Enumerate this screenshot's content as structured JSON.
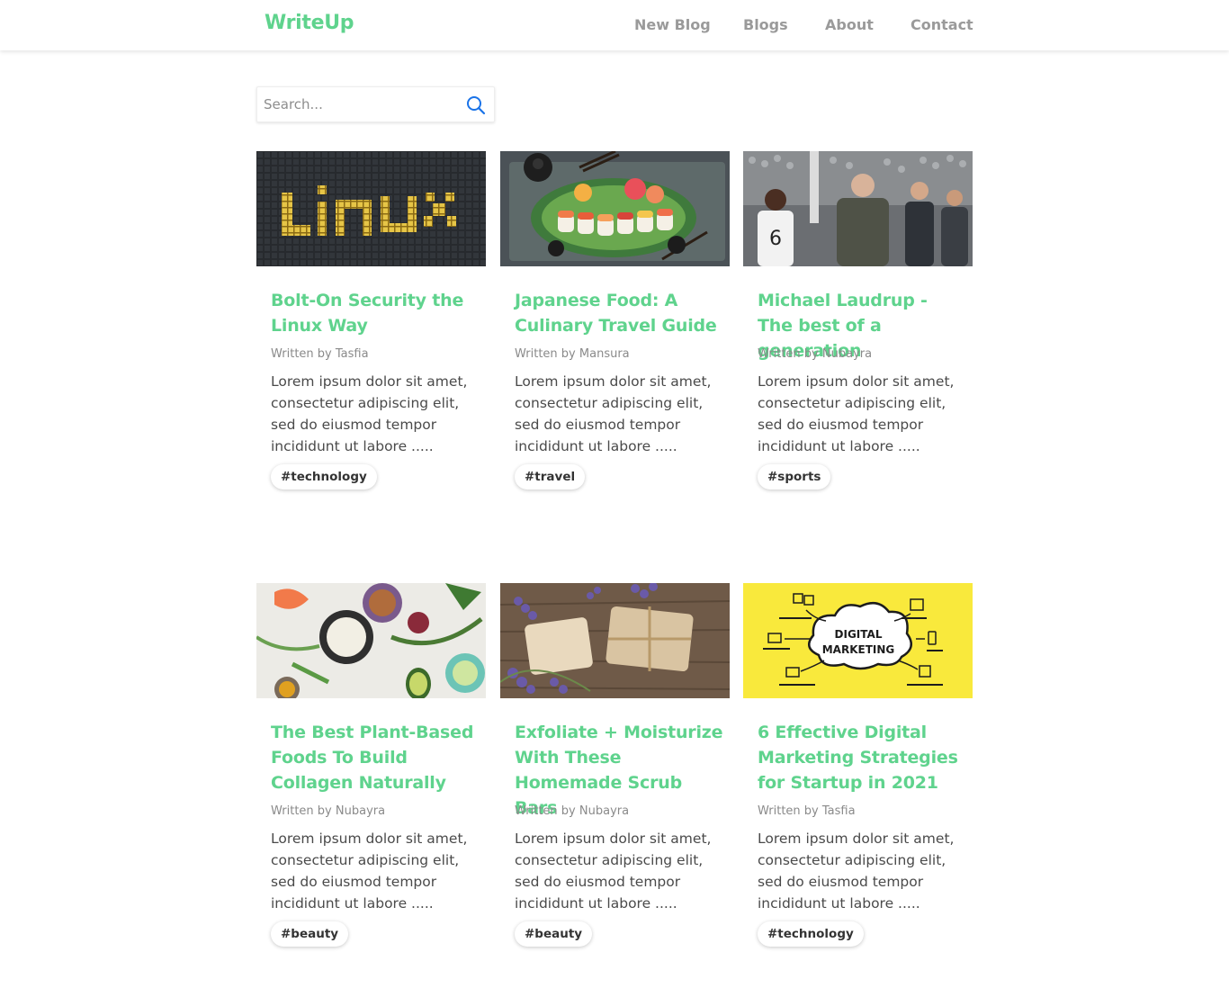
{
  "header": {
    "brand": "WriteUp",
    "nav": [
      {
        "label": "New Blog"
      },
      {
        "label": "Blogs"
      },
      {
        "label": "About"
      },
      {
        "label": "Contact"
      }
    ],
    "colors": {
      "brand": "#5fd38d",
      "nav_text": "#9a9a9a"
    }
  },
  "search": {
    "placeholder": "Search...",
    "value": "",
    "icon": "search-icon",
    "icon_color": "#1a73e8"
  },
  "posts": [
    {
      "title": "Bolt-On Security the Linux Way",
      "written_by": "Written by",
      "author": "Tasfia",
      "excerpt": "Lorem ipsum dolor sit amet, consectetur adipiscing elit, sed do eiusmod tempor incididunt ut labore .....",
      "tag": "#technology",
      "image": "linux-image"
    },
    {
      "title": "Japanese Food: A Culinary Travel Guide",
      "written_by": "Written by",
      "author": "Mansura",
      "excerpt": "Lorem ipsum dolor sit amet, consectetur adipiscing elit, sed do eiusmod tempor incididunt ut labore .....",
      "tag": "#travel",
      "image": "sushi-image"
    },
    {
      "title": "Michael Laudrup - The best of a generation",
      "written_by": "Written by",
      "author": "Nubayra",
      "excerpt": "Lorem ipsum dolor sit amet, consectetur adipiscing elit, sed do eiusmod tempor incididunt ut labore .....",
      "tag": "#sports",
      "image": "football-image"
    },
    {
      "title": "The Best Plant-Based Foods To Build Collagen Naturally",
      "written_by": "Written by",
      "author": "Nubayra",
      "excerpt": "Lorem ipsum dolor sit amet, consectetur adipiscing elit, sed do eiusmod tempor incididunt ut labore .....",
      "tag": "#beauty",
      "image": "plant-foods-image"
    },
    {
      "title": "Exfoliate + Moisturize With These Homemade Scrub Bars",
      "written_by": "Written by",
      "author": "Nubayra",
      "excerpt": "Lorem ipsum dolor sit amet, consectetur adipiscing elit, sed do eiusmod tempor incididunt ut labore .....",
      "tag": "#beauty",
      "image": "soap-lavender-image"
    },
    {
      "title": "6 Effective Digital Marketing Strategies for Startup in 2021",
      "written_by": "Written by",
      "author": "Tasfia",
      "excerpt": "Lorem ipsum dolor sit amet, consectetur adipiscing elit, sed do eiusmod tempor incididunt ut labore .....",
      "tag": "#technology",
      "image": "digital-marketing-image",
      "image_text": [
        "DIGITAL",
        "MARKETING"
      ]
    }
  ]
}
